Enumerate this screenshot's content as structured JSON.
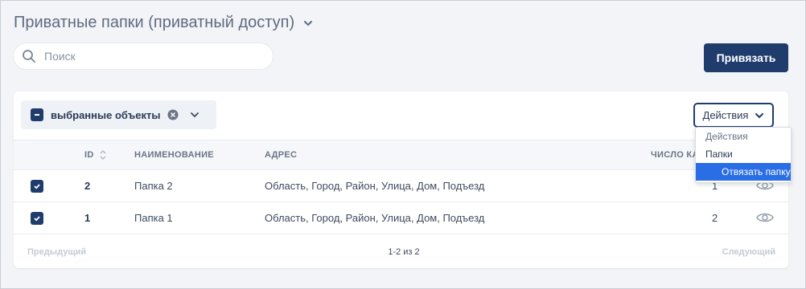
{
  "header": {
    "title": "Приватные папки (приватный доступ)"
  },
  "search": {
    "placeholder": "Поиск"
  },
  "toolbar": {
    "bind_label": "Привязать"
  },
  "selection": {
    "label": "выбранные объекты"
  },
  "actions": {
    "label": "Действия"
  },
  "table": {
    "columns": {
      "id": "ID",
      "name": "НАИМЕНОВАНИЕ",
      "address": "АДРЕС",
      "count": "ЧИСЛО КА"
    },
    "rows": [
      {
        "id": "2",
        "name": "Папка 2",
        "address": "Область, Город, Район, Улица, Дом, Подъезд",
        "count": "1",
        "checked": true
      },
      {
        "id": "1",
        "name": "Папка 1",
        "address": "Область, Город, Район, Улица, Дом, Подъезд",
        "count": "2",
        "checked": true
      }
    ]
  },
  "pagination": {
    "prev": "Предыдущий",
    "info": "1-2 из 2",
    "next": "Следующий"
  },
  "dropdown": {
    "header": "Действия",
    "group": "Папки",
    "item": "Отвязать папку"
  },
  "colors": {
    "primary": "#1f3c6d",
    "highlight": "#2a6ee6",
    "background": "#f2f4f7"
  }
}
